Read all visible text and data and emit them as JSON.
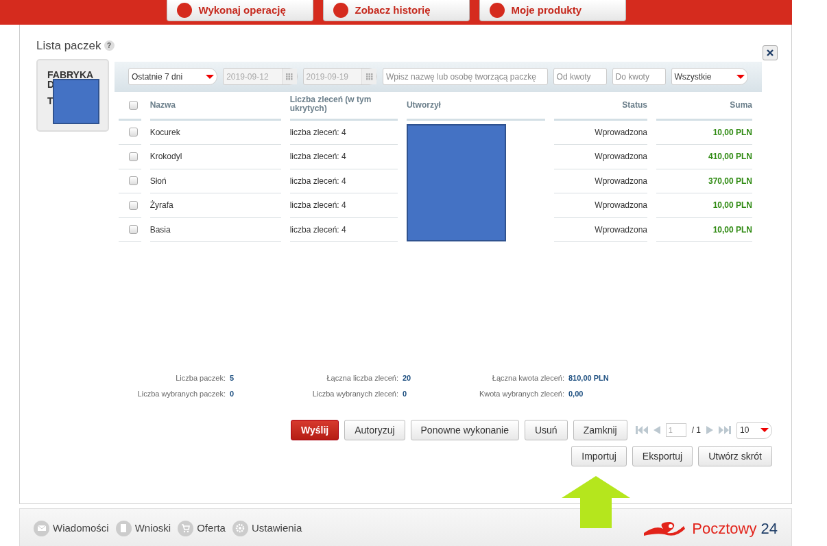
{
  "top_buttons": [
    {
      "label": "Wykonaj operację"
    },
    {
      "label": "Zobacz historię"
    },
    {
      "label": "Moje produkty"
    }
  ],
  "title": "Lista paczek",
  "help_mark": "?",
  "company_card": {
    "lines": [
      "FABRYKA",
      "D",
      "T"
    ]
  },
  "filters": {
    "period": "Ostatnie 7 dni",
    "date_from": "2019-09-12",
    "date_to": "2019-09-19",
    "search_placeholder": "Wpisz nazwę lub osobę tworzącą paczkę",
    "amount_from_placeholder": "Od kwoty",
    "amount_to_placeholder": "Do kwoty",
    "status": "Wszystkie"
  },
  "table": {
    "columns": [
      "Nazwa",
      "Liczba zleceń (w tym ukrytych)",
      "Utworzył",
      "Status",
      "Suma"
    ],
    "header_checked": false,
    "rows": [
      {
        "checked": false,
        "name": "Kocurek",
        "orders": "liczba zleceń: 4",
        "status": "Wprowadzona",
        "sum": "10,00 PLN"
      },
      {
        "checked": false,
        "name": "Krokodyl",
        "orders": "liczba zleceń: 4",
        "status": "Wprowadzona",
        "sum": "410,00 PLN"
      },
      {
        "checked": false,
        "name": "Słoń",
        "orders": "liczba zleceń: 4",
        "status": "Wprowadzona",
        "sum": "370,00 PLN"
      },
      {
        "checked": false,
        "name": "Żyrafa",
        "orders": "liczba zleceń: 4",
        "status": "Wprowadzona",
        "sum": "10,00 PLN"
      },
      {
        "checked": false,
        "name": "Basia",
        "orders": "liczba zleceń: 4",
        "status": "Wprowadzona",
        "sum": "10,00 PLN"
      }
    ]
  },
  "summary": [
    {
      "label": "Liczba paczek:",
      "value": "5"
    },
    {
      "label": "Łączna liczba zleceń:",
      "value": "20"
    },
    {
      "label": "Łączna kwota zleceń:",
      "value": "810,00 PLN"
    },
    {
      "label": "Liczba wybranych paczek:",
      "value": "0"
    },
    {
      "label": "Liczba wybranych zleceń:",
      "value": "0"
    },
    {
      "label": "Kwota wybranych zleceń:",
      "value": "0,00"
    }
  ],
  "actions": [
    {
      "label": "Wyślij",
      "kind": "primary"
    },
    {
      "label": "Autoryzuj",
      "kind": "default"
    },
    {
      "label": "Ponowne wykonanie",
      "kind": "default"
    },
    {
      "label": "Usuń",
      "kind": "default"
    },
    {
      "label": "Zamknij",
      "kind": "default"
    }
  ],
  "pagination": {
    "page": "1",
    "total": "/ 1",
    "per_page": "10"
  },
  "actions2": [
    {
      "label": "Importuj"
    },
    {
      "label": "Eksportuj"
    },
    {
      "label": "Utwórz skrót"
    }
  ],
  "footer": {
    "links": [
      {
        "label": "Wiadomości",
        "kind": "mail"
      },
      {
        "label": "Wnioski",
        "kind": "doc"
      },
      {
        "label": "Oferta",
        "kind": "cart"
      },
      {
        "label": "Ustawienia",
        "kind": "gear"
      }
    ],
    "brand": "Pocztowy",
    "brand_number": "24"
  }
}
